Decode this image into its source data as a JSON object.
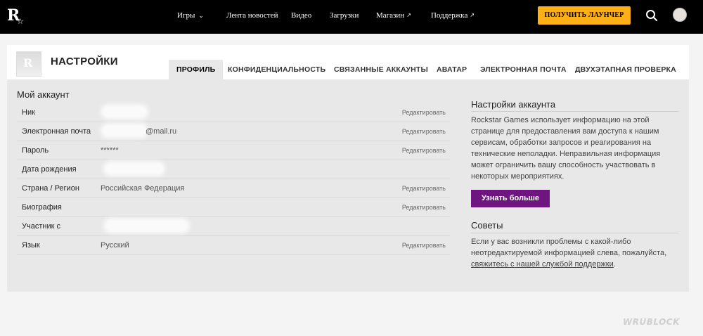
{
  "nav": {
    "logo": "R",
    "items": [
      {
        "label": "Игры",
        "icon": "chevron-down-icon"
      },
      {
        "label": "Лента новостей"
      },
      {
        "label": "Видео"
      },
      {
        "label": "Загрузки"
      },
      {
        "label": "Магазин",
        "icon": "external-link-icon"
      },
      {
        "label": "Поддержка",
        "icon": "external-link-icon"
      }
    ],
    "cta_label": "ПОЛУЧИТЬ ЛАУНЧЕР",
    "cta_color": "#fcaf17"
  },
  "header": {
    "title": "НАСТРОЙКИ",
    "tabs": [
      {
        "label": "ПРОФИЛЬ",
        "active": true
      },
      {
        "label": "КОНФИДЕНЦИАЛЬНОСТЬ"
      },
      {
        "label": "СВЯЗАННЫЕ АККАУНТЫ"
      },
      {
        "label": "АВАТАР"
      },
      {
        "label": "ЭЛЕКТРОННАЯ ПОЧТА"
      },
      {
        "label": "ДВУХЭТАПНАЯ ПРОВЕРКА"
      }
    ]
  },
  "account": {
    "title": "Мой аккаунт",
    "rows": [
      {
        "label": "Ник",
        "value": "",
        "edit": "Редактировать"
      },
      {
        "label": "Электронная почта",
        "value": "@mail.ru",
        "edit": "Редактировать"
      },
      {
        "label": "Пароль",
        "value": "******",
        "edit": "Редактировать"
      },
      {
        "label": "Дата рождения",
        "value": "",
        "edit": ""
      },
      {
        "label": "Страна / Регион",
        "value": "Российская Федерация",
        "edit": "Редактировать"
      },
      {
        "label": "Биография",
        "value": "",
        "edit": "Редактировать"
      },
      {
        "label": "Участник с",
        "value": "",
        "edit": ""
      },
      {
        "label": "Язык",
        "value": "Русский",
        "edit": "Редактировать"
      }
    ]
  },
  "sidebar": {
    "settings_title": "Настройки аккаунта",
    "settings_text": "Rockstar Games использует информацию на этой странице для предоставления вам доступа к нашим сервисам, обработки запросов и реагирования на технические неполадки. Неправильная информация может ограничить вашу способность участвовать в некоторых мероприятиях.",
    "learn_more": "Узнать больше",
    "tips_title": "Советы",
    "tips_text": "Если у вас возникли проблемы с какой-либо неотредактируемой информацией слева, пожалуйста,",
    "tips_link": "свяжитесь с нашей службой поддержки",
    "tips_end": ".",
    "button_color": "#6e1580"
  },
  "watermark": "WRUBLOCK"
}
